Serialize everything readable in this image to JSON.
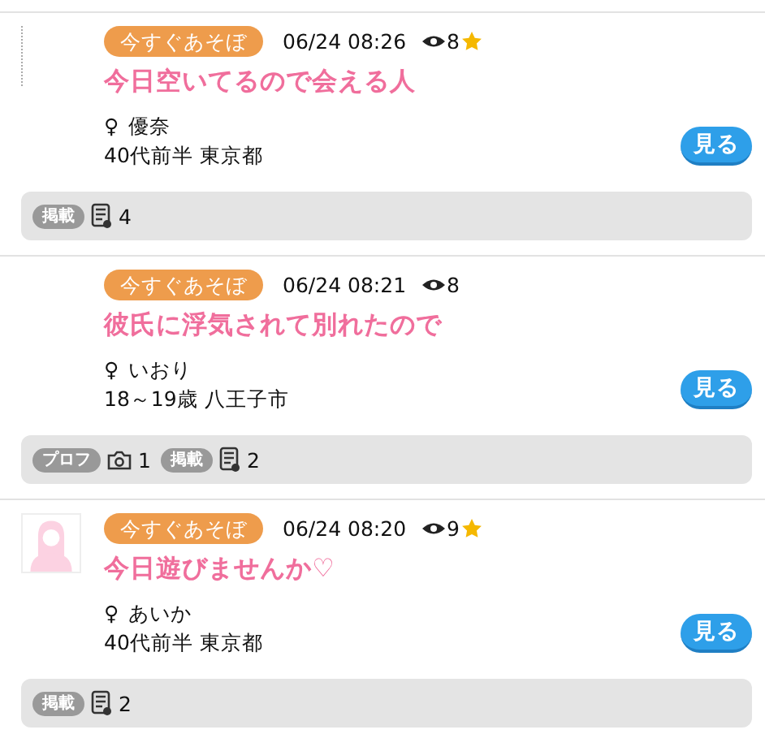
{
  "posts": [
    {
      "avatar": {
        "kind": "broken"
      },
      "badge": "今すぐあそぼ",
      "time": "06/24 08:26",
      "views": "8",
      "starred": true,
      "title": "今日空いてるので会える人",
      "gender": "♀",
      "name": "優奈",
      "profile": "40代前半 東京都",
      "button": "見る",
      "footer": [
        {
          "kind": "tag",
          "label": "掲載"
        },
        {
          "kind": "doc",
          "count": "4"
        }
      ]
    },
    {
      "badge": "今すぐあそぼ",
      "time": "06/24 08:21",
      "views": "8",
      "starred": false,
      "title": "彼氏に浮気されて別れたので",
      "gender": "♀",
      "name": "いおり",
      "profile": "18～19歳 八王子市",
      "button": "見る",
      "footer": [
        {
          "kind": "tag",
          "label": "プロフ"
        },
        {
          "kind": "camera",
          "count": "1"
        },
        {
          "kind": "tag",
          "label": "掲載"
        },
        {
          "kind": "doc",
          "count": "2"
        }
      ]
    },
    {
      "avatar": {
        "kind": "silhouette"
      },
      "badge": "今すぐあそぼ",
      "time": "06/24 08:20",
      "views": "9",
      "starred": true,
      "title": "今日遊びませんか♡",
      "gender": "♀",
      "name": "あいか",
      "profile": "40代前半 東京都",
      "button": "見る",
      "footer": [
        {
          "kind": "tag",
          "label": "掲載"
        },
        {
          "kind": "doc",
          "count": "2"
        }
      ]
    }
  ]
}
